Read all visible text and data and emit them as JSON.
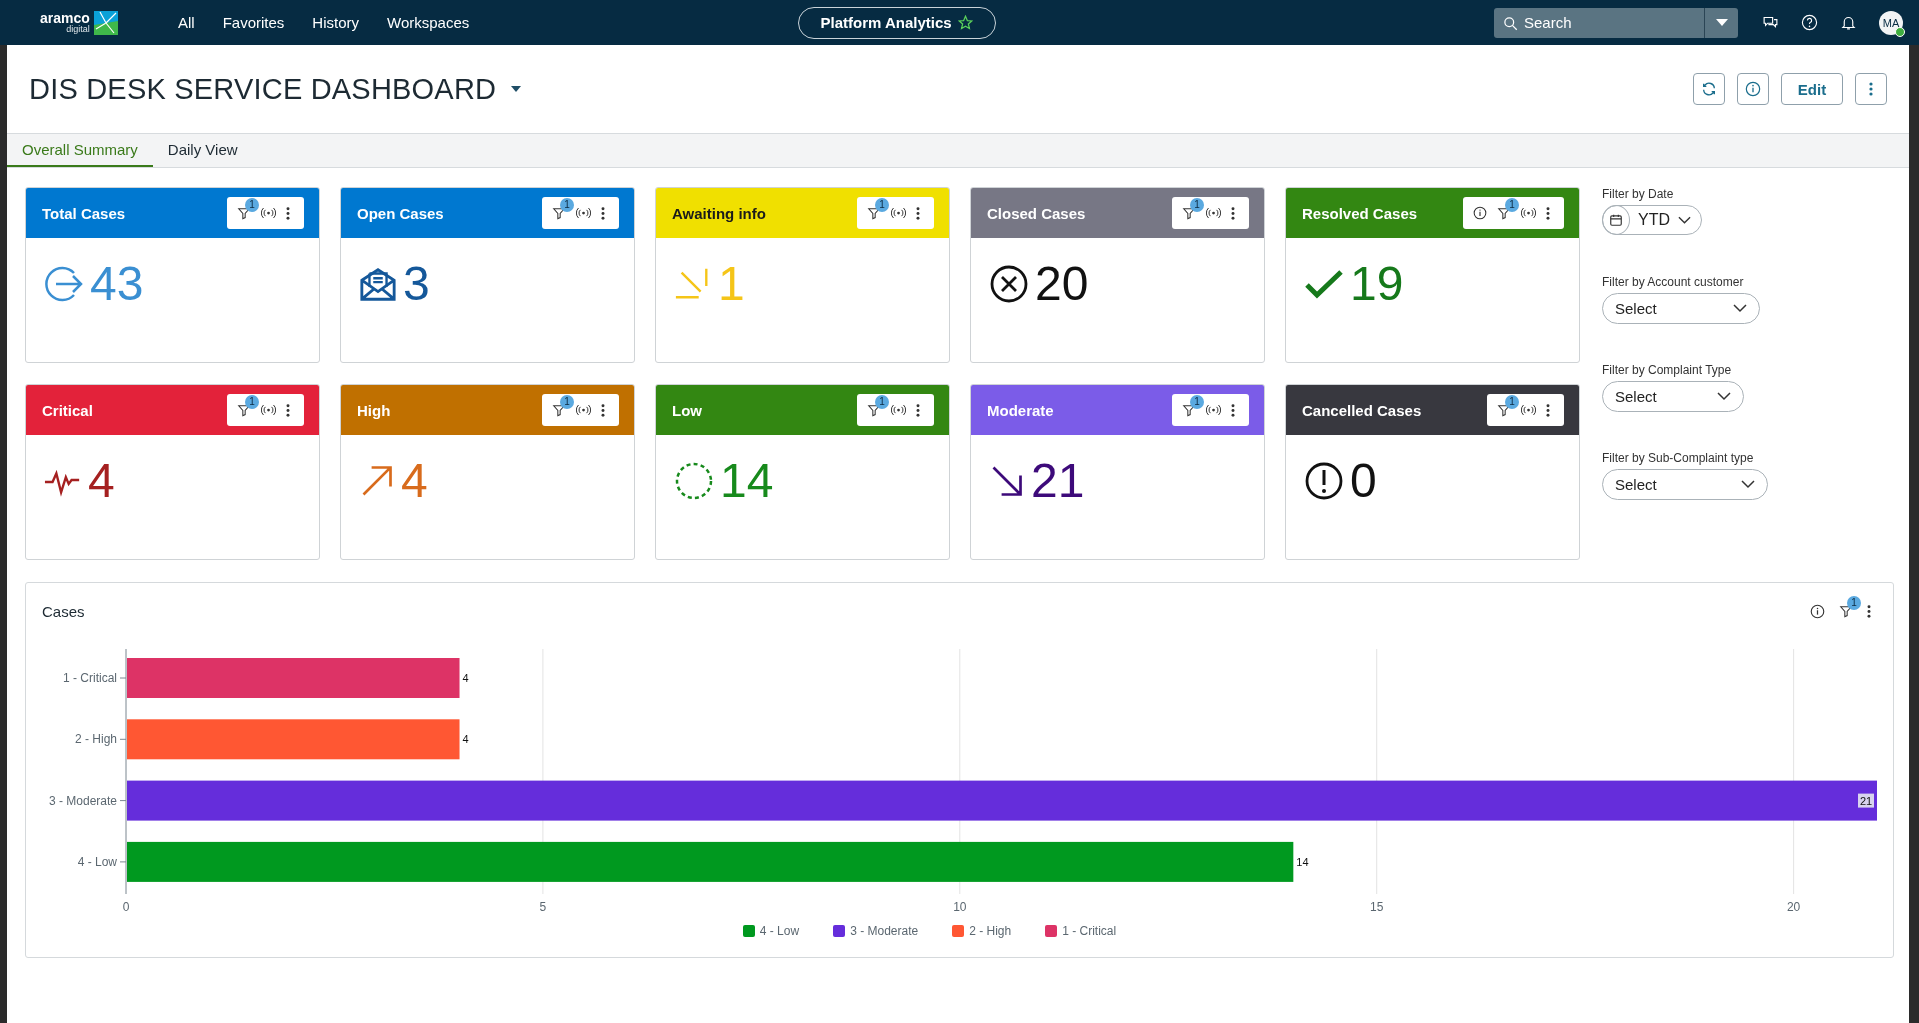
{
  "topbar": {
    "logo": {
      "name": "aramco",
      "sub": "digital"
    },
    "nav": [
      {
        "label": "All"
      },
      {
        "label": "Favorites"
      },
      {
        "label": "History"
      },
      {
        "label": "Workspaces"
      }
    ],
    "app": {
      "label": "Platform Analytics"
    },
    "search": {
      "placeholder": "Search"
    },
    "avatar": {
      "initials": "MA",
      "online": true
    }
  },
  "dashboard": {
    "title": "DIS DESK SERVICE DASHBOARD",
    "edit_label": "Edit"
  },
  "tabs": [
    {
      "label": "Overall Summary",
      "selected": true
    },
    {
      "label": "Daily View",
      "selected": false
    }
  ],
  "cards": [
    {
      "title": "Total Cases",
      "color": "#0078d0",
      "value": {
        "text": "43",
        "color": "#3a8fd2"
      },
      "kind": "enter",
      "info": false,
      "filter_count": "1"
    },
    {
      "title": "Open Cases",
      "color": "#0078d0",
      "value": {
        "text": "3",
        "color": "#15589a"
      },
      "kind": "mail",
      "info": false,
      "filter_count": "1"
    },
    {
      "title": "Awaiting info",
      "color": "#f0e000",
      "value": {
        "text": "1",
        "color": "#f5c518"
      },
      "kind": "incoming",
      "info": false,
      "filter_count": "1"
    },
    {
      "title": "Closed Cases",
      "color": "#777785",
      "value": {
        "text": "20",
        "color": "#111111"
      },
      "kind": "x-circle",
      "info": false,
      "filter_count": "1"
    },
    {
      "title": "Resolved Cases",
      "color": "#338712",
      "value": {
        "text": "19",
        "color": "#16791b"
      },
      "kind": "check",
      "info": true,
      "filter_count": "1"
    },
    {
      "title": "Critical",
      "color": "#e3223a",
      "value": {
        "text": "4",
        "color": "#a52020"
      },
      "kind": "pulse",
      "info": false,
      "filter_count": "1"
    },
    {
      "title": "High",
      "color": "#c07000",
      "value": {
        "text": "4",
        "color": "#d86b1c"
      },
      "kind": "up-right",
      "info": false,
      "filter_count": "1"
    },
    {
      "title": "Low",
      "color": "#338712",
      "value": {
        "text": "14",
        "color": "#178a1c"
      },
      "kind": "dashed-circle",
      "info": false,
      "filter_count": "1"
    },
    {
      "title": "Moderate",
      "color": "#7b5ce8",
      "value": {
        "text": "21",
        "color": "#3d0a7a"
      },
      "kind": "down-right",
      "info": false,
      "filter_count": "1"
    },
    {
      "title": "Cancelled Cases",
      "color": "#38383f",
      "value": {
        "text": "0",
        "color": "#111111"
      },
      "kind": "alert-circle",
      "info": false,
      "filter_count": "1"
    }
  ],
  "filters": [
    {
      "kind": "date",
      "label": "Filter by Date",
      "value": "YTD"
    },
    {
      "kind": "select",
      "label": "Filter by Account customer",
      "value": "Select"
    },
    {
      "kind": "select",
      "label": "Filter by Complaint Type",
      "value": "Select"
    },
    {
      "kind": "select",
      "label": "Filter by Sub-Complaint type",
      "value": "Select"
    }
  ],
  "chart_panel": {
    "title": "Cases",
    "filter_count": "1",
    "chart_data": {
      "type": "bar",
      "orientation": "horizontal",
      "stacked": true,
      "categories": [
        "1 - Critical",
        "2 - High",
        "3 - Moderate",
        "4 - Low"
      ],
      "series": [
        {
          "name": "4 - Low",
          "color": "#00991f",
          "values": [
            null,
            null,
            null,
            14
          ]
        },
        {
          "name": "3 - Moderate",
          "color": "#652ddb",
          "values": [
            null,
            null,
            21,
            null
          ]
        },
        {
          "name": "2 - High",
          "color": "#ff5733",
          "values": [
            null,
            4,
            null,
            null
          ]
        },
        {
          "name": "1 - Critical",
          "color": "#dd3366",
          "values": [
            4,
            null,
            null,
            null
          ]
        }
      ],
      "xlim": [
        0,
        21
      ],
      "xticks": [
        0,
        5,
        10,
        15,
        20
      ],
      "grid": true,
      "data_labels": true
    }
  }
}
